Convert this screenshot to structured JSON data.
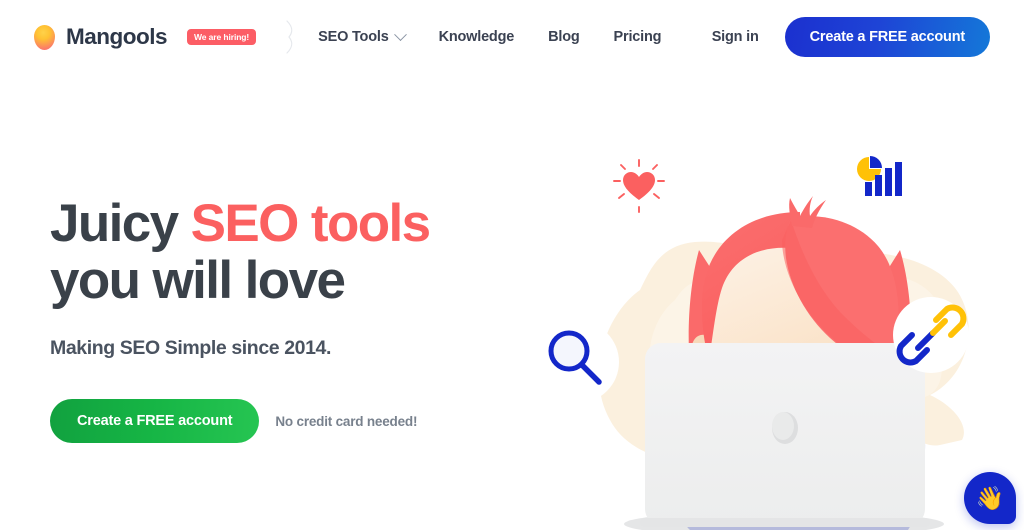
{
  "header": {
    "brand": {
      "logo_icon": "mango-logo-icon",
      "name": "Mangools",
      "hiring_badge": "We are hiring!"
    },
    "nav": [
      {
        "label": "SEO Tools",
        "has_dropdown": true,
        "icon": "chevron-down-icon"
      },
      {
        "label": "Knowledge",
        "has_dropdown": false
      },
      {
        "label": "Blog",
        "has_dropdown": false
      },
      {
        "label": "Pricing",
        "has_dropdown": false
      }
    ],
    "sign_in": "Sign in",
    "cta": "Create a FREE account"
  },
  "hero": {
    "headline_line1_plain": "Juicy ",
    "headline_line1_accent": "SEO tools",
    "headline_line2": "you will love",
    "subhead": "Making SEO Simple since 2014.",
    "cta": "Create a FREE account",
    "note": "No credit card needed!"
  },
  "illustration": {
    "alt": "woman-with-laptop-illustration",
    "badges": [
      {
        "name": "heart-icon",
        "position": "top-left"
      },
      {
        "name": "bar-chart-icon",
        "position": "top-right"
      },
      {
        "name": "magnifier-icon",
        "position": "mid-left"
      },
      {
        "name": "link-chain-icon",
        "position": "mid-right"
      }
    ]
  },
  "chat_widget": {
    "icon": "waving-hand-icon",
    "glyph": "👋"
  },
  "colors": {
    "accent_coral": "#fb6060",
    "brand_blue": "#1327c9",
    "cta_green": "#16b545",
    "text_dark": "#3a4149",
    "blob_cream": "#fbf0df",
    "hair_coral": "#fa6a6a",
    "skin": "#fbe3c8",
    "chart_yellow": "#ffc107"
  }
}
